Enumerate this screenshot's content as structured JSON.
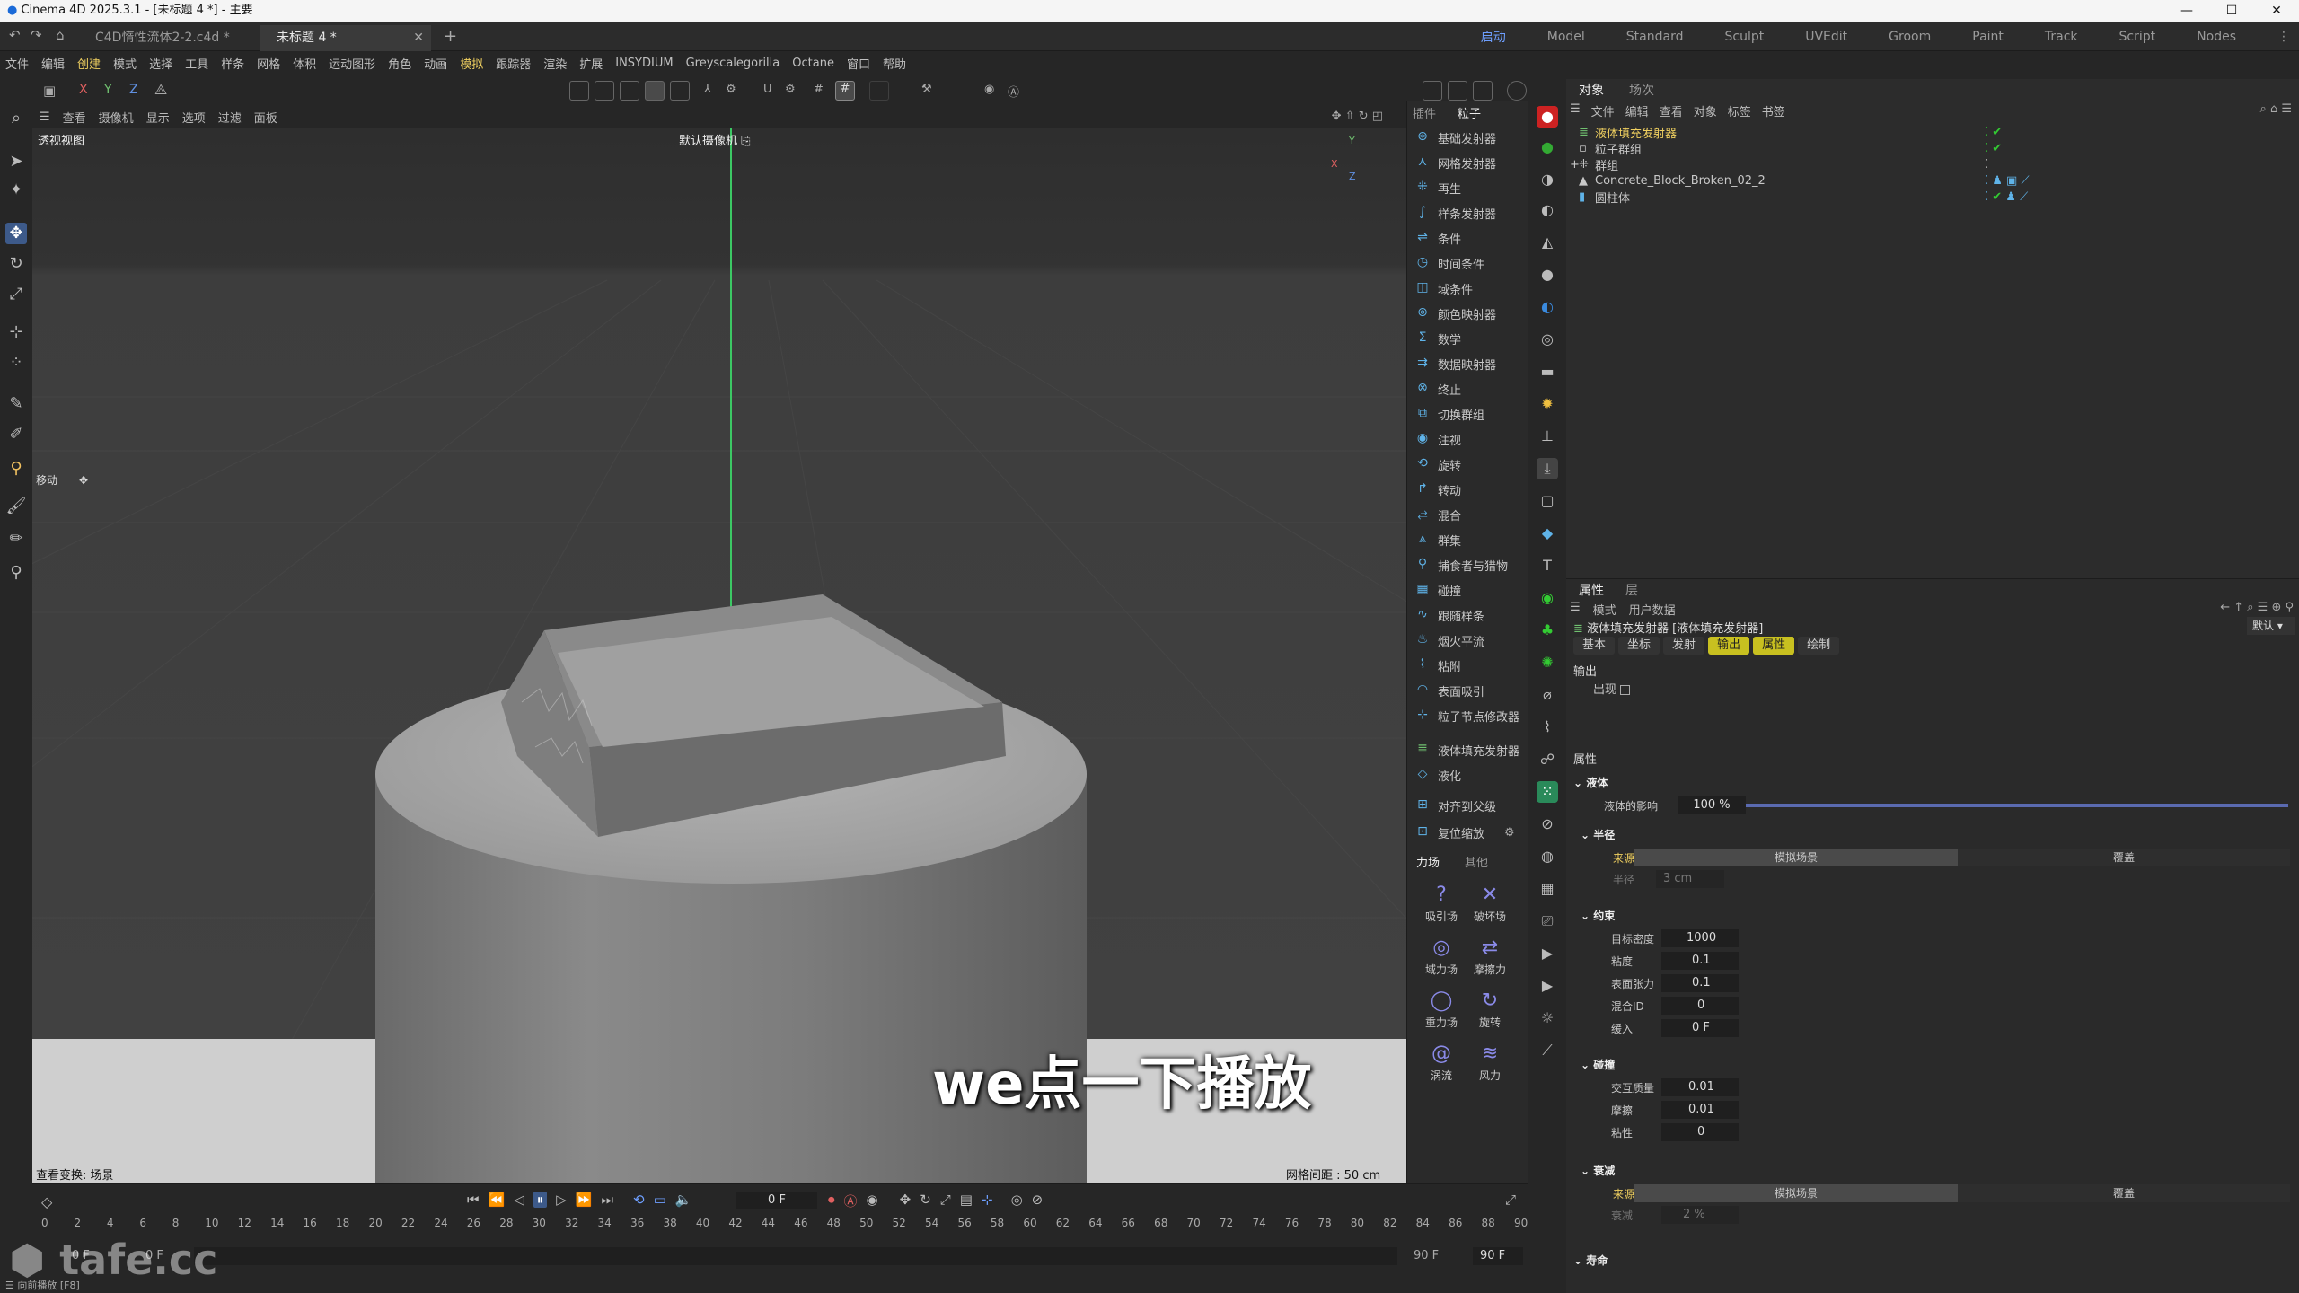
{
  "app": {
    "title": "Cinema 4D 2025.3.1 - [未标题 4 *] - 主要"
  },
  "tabs": [
    {
      "label": "C4D惰性流体2-2.c4d *"
    },
    {
      "label": "未标题 4 *"
    }
  ],
  "layouts": [
    "启动",
    "Model",
    "Standard",
    "Sculpt",
    "UVEdit",
    "Groom",
    "Paint",
    "Track",
    "Script",
    "Nodes"
  ],
  "menu": [
    "文件",
    "编辑",
    "创建",
    "模式",
    "选择",
    "工具",
    "样条",
    "网格",
    "体积",
    "运动图形",
    "角色",
    "动画",
    "模拟",
    "跟踪器",
    "渲染",
    "扩展",
    "INSYDIUM",
    "Greyscalegorilla",
    "Octane",
    "窗口",
    "帮助"
  ],
  "axes_toolbar": [
    "X",
    "Y",
    "Z"
  ],
  "viewport": {
    "menu": [
      "查看",
      "摄像机",
      "显示",
      "选项",
      "过滤",
      "面板"
    ],
    "label": "透视视图",
    "camera": "默认摄像机",
    "move_label": "移动",
    "status_left": "查看变换: 场景",
    "grid_spacing": "网格间距 : 50 cm",
    "axis_x": "X",
    "axis_y": "Y",
    "axis_z": "Z"
  },
  "plugin_panel": {
    "tabs": [
      "插件",
      "粒子"
    ],
    "items": [
      "基础发射器",
      "网格发射器",
      "再生",
      "样条发射器",
      "条件",
      "时间条件",
      "域条件",
      "颜色映射器",
      "数学",
      "数据映射器",
      "终止",
      "切换群组",
      "注视",
      "旋转",
      "转动",
      "混合",
      "群集",
      "捕食者与猎物",
      "碰撞",
      "跟随样条",
      "烟火平流",
      "粘附",
      "表面吸引",
      "粒子节点修改器"
    ],
    "fluid_items": [
      "液体填充发射器",
      "液化"
    ],
    "actions": [
      "对齐到父级",
      "复位缩放"
    ],
    "force_tabs": [
      "力场",
      "其他"
    ],
    "forces": [
      {
        "label": "吸引场",
        "icon": "?"
      },
      {
        "label": "破坏场",
        "icon": "✕"
      },
      {
        "label": "域力场",
        "icon": "◎"
      },
      {
        "label": "摩擦力",
        "icon": "⇄"
      },
      {
        "label": "重力场",
        "icon": "◯"
      },
      {
        "label": "旋转",
        "icon": "↻"
      },
      {
        "label": "涡流",
        "icon": "@"
      },
      {
        "label": "风力",
        "icon": "≋"
      }
    ]
  },
  "object_manager": {
    "tabs": [
      "对象",
      "场次"
    ],
    "menu": [
      "文件",
      "编辑",
      "查看",
      "对象",
      "标签",
      "书签"
    ],
    "objects": [
      {
        "name": "液体填充发射器",
        "highlight": true
      },
      {
        "name": "粒子群组",
        "highlight": false
      },
      {
        "name": "群组",
        "highlight": false
      },
      {
        "name": "Concrete_Block_Broken_02_2",
        "highlight": false
      },
      {
        "name": "圆柱体",
        "highlight": false
      }
    ]
  },
  "attributes": {
    "tabs": [
      "属性",
      "层"
    ],
    "menu": [
      "模式",
      "用户数据"
    ],
    "object_title": "液体填充发射器 [液体填充发射器]",
    "preset": "默认",
    "subtabs": [
      "基本",
      "坐标",
      "发射",
      "输出",
      "属性",
      "绘制"
    ],
    "output_header": "输出",
    "appear_label": "出现",
    "props_header": "属性",
    "fluid_group": "液体",
    "fluid_influence_label": "液体的影响",
    "fluid_influence_value": "100 %",
    "fluid_influence": 1.0,
    "radius_group": "半径",
    "source_label": "来源",
    "source_sim": "模拟场景",
    "source_override": "覆盖",
    "radius_label": "半径",
    "radius_value": "3 cm",
    "constraint_group": "约束",
    "target_density_label": "目标密度",
    "target_density": "1000",
    "viscosity_label": "粘度",
    "viscosity": "0.1",
    "surface_tension_label": "表面张力",
    "surface_tension": "0.1",
    "mix_id_label": "混合ID",
    "mix_id": "0",
    "ease_label": "缓入",
    "ease": "0 F",
    "collision_group": "碰撞",
    "mass_label": "交互质量",
    "mass": "0.01",
    "friction_label": "摩擦",
    "friction": "0.01",
    "stickiness_label": "粘性",
    "stickiness": "0",
    "decay_group": "衰减",
    "decay_source_label": "来源",
    "decay_label": "衰减",
    "decay_value": "2 %",
    "life_group": "寿命"
  },
  "timeline": {
    "current_frame": "0 F",
    "ticks": [
      "0",
      "2",
      "4",
      "6",
      "8",
      "10",
      "12",
      "14",
      "16",
      "18",
      "20",
      "22",
      "24",
      "26",
      "28",
      "30",
      "32",
      "34",
      "36",
      "38",
      "40",
      "42",
      "44",
      "46",
      "48",
      "50",
      "52",
      "54",
      "56",
      "58",
      "60",
      "62",
      "64",
      "66",
      "68",
      "70",
      "72",
      "74",
      "76",
      "78",
      "80",
      "82",
      "84",
      "86",
      "88",
      "90"
    ],
    "start": "0 F",
    "start2": "0 F",
    "end": "90 F",
    "end2": "90 F",
    "status": "向前播放 [F8]"
  },
  "watermark": "tafe.cc",
  "subtitle": "we点一下播放",
  "colors": {
    "accent": "#6e9fff",
    "highlight": "#f0d060",
    "green_axis": "#3cc864"
  }
}
